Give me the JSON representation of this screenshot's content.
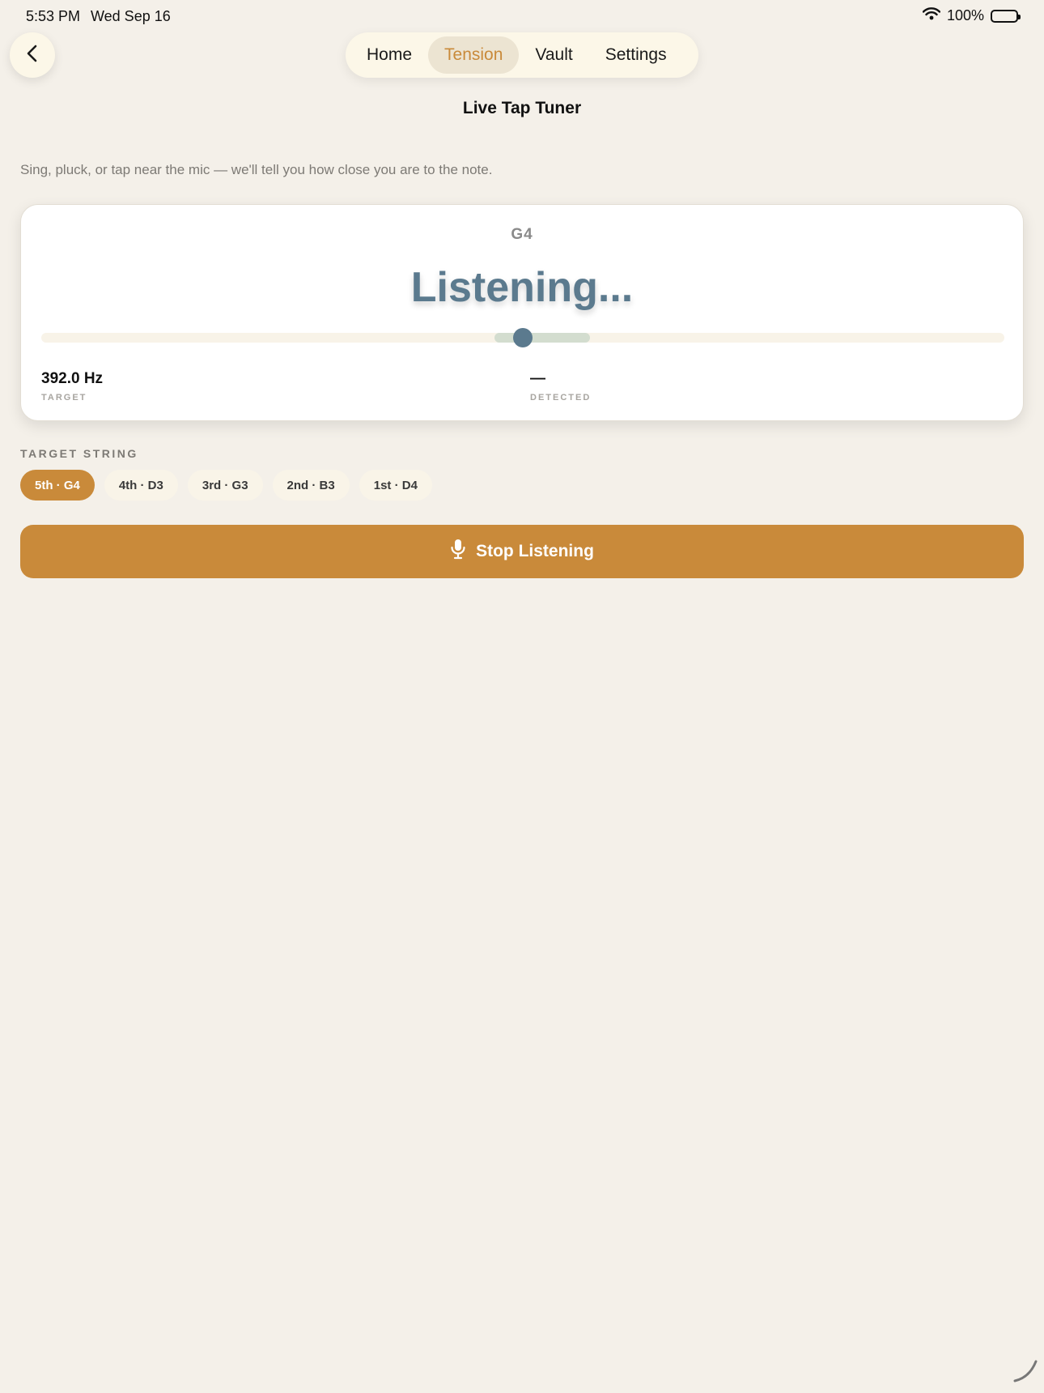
{
  "status_bar": {
    "time": "5:53 PM",
    "date": "Wed Sep 16",
    "battery": "100%",
    "icons": [
      "wifi-icon",
      "battery-icon"
    ]
  },
  "nav": {
    "back_icon": "chevron-left-icon",
    "tabs": [
      {
        "label": "Home",
        "active": false
      },
      {
        "label": "Tension",
        "active": true
      },
      {
        "label": "Vault",
        "active": false
      },
      {
        "label": "Settings",
        "active": false
      }
    ]
  },
  "page": {
    "title": "Live Tap Tuner",
    "subtitle": "Sing, pluck, or tap near the mic — we'll tell you how close you are to the note."
  },
  "tuner": {
    "note": "G4",
    "status": "Listening...",
    "target_value": "392.0 Hz",
    "target_label": "TARGET",
    "detected_value": "—",
    "detected_label": "DETECTED",
    "needle_position": 0.5
  },
  "strings": {
    "label": "TARGET STRING",
    "options": [
      {
        "label": "5th · G4",
        "active": true
      },
      {
        "label": "4th · D3",
        "active": false
      },
      {
        "label": "3rd · G3",
        "active": false
      },
      {
        "label": "2nd · B3",
        "active": false
      },
      {
        "label": "1st · D4",
        "active": false
      }
    ]
  },
  "action": {
    "label": "Stop Listening",
    "icon": "microphone-icon"
  },
  "colors": {
    "background": "#f4f0e9",
    "accent": "#c98a3a",
    "slate": "#5b7a8e",
    "in_tune_zone": "#d3ddcf"
  }
}
